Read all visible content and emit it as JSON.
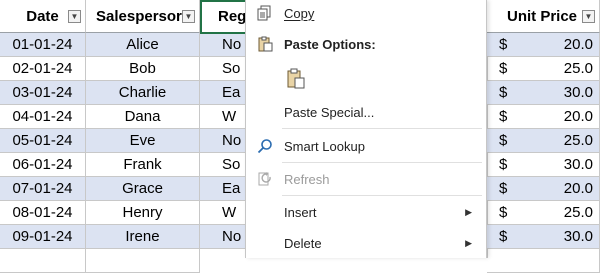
{
  "table": {
    "headers": {
      "date": "Date",
      "salesperson": "Salespersor",
      "region": "Reg",
      "unit_price": "Unit Price"
    },
    "rows": [
      {
        "date": "01-01-24",
        "salesperson": "Alice",
        "region": "No",
        "currency": "$",
        "price": "20.0"
      },
      {
        "date": "02-01-24",
        "salesperson": "Bob",
        "region": "So",
        "currency": "$",
        "price": "25.0"
      },
      {
        "date": "03-01-24",
        "salesperson": "Charlie",
        "region": "Ea",
        "currency": "$",
        "price": "30.0"
      },
      {
        "date": "04-01-24",
        "salesperson": "Dana",
        "region": "W",
        "currency": "$",
        "price": "20.0"
      },
      {
        "date": "05-01-24",
        "salesperson": "Eve",
        "region": "No",
        "currency": "$",
        "price": "25.0"
      },
      {
        "date": "06-01-24",
        "salesperson": "Frank",
        "region": "So",
        "currency": "$",
        "price": "30.0"
      },
      {
        "date": "07-01-24",
        "salesperson": "Grace",
        "region": "Ea",
        "currency": "$",
        "price": "20.0"
      },
      {
        "date": "08-01-24",
        "salesperson": "Henry",
        "region": "W",
        "currency": "$",
        "price": "25.0"
      },
      {
        "date": "09-01-24",
        "salesperson": "Irene",
        "region": "No",
        "currency": "$",
        "price": "30.0"
      }
    ],
    "band_color": "#dce3f2",
    "selection_color": "#217346"
  },
  "context_menu": {
    "copy": "Copy",
    "paste_options": "Paste Options:",
    "paste_special": "Paste Special...",
    "smart_lookup": "Smart Lookup",
    "refresh": "Refresh",
    "insert": "Insert",
    "delete": "Delete",
    "submenu_arrow": "▶"
  }
}
